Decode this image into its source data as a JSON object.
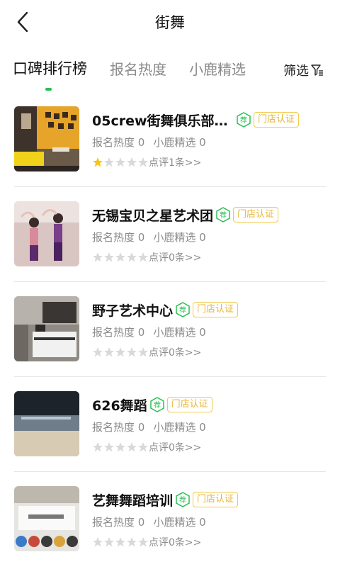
{
  "header": {
    "title": "街舞",
    "back_icon": "chevron-left-icon"
  },
  "tabs": [
    {
      "label": "口碑排行榜",
      "active": true
    },
    {
      "label": "报名热度",
      "active": false
    },
    {
      "label": "小鹿精选",
      "active": false
    }
  ],
  "filter": {
    "label": "筛选",
    "icon": "filter-icon"
  },
  "colors": {
    "accent": "#2bbf55",
    "cert": "#e8b634",
    "star_on": "#f5c518",
    "star_off": "#d9d9d9"
  },
  "items": [
    {
      "name": "05crew街舞俱乐部(大...",
      "rec_badge": "荐",
      "cert_badge": "门店认证",
      "signup": "报名热度 0",
      "picks": "小鹿精选 0",
      "rating": 1,
      "reviews": "点评1条>>"
    },
    {
      "name": "无锡宝贝之星艺术团",
      "rec_badge": "荐",
      "cert_badge": "门店认证",
      "signup": "报名热度 0",
      "picks": "小鹿精选 0",
      "rating": 0,
      "reviews": "点评0条>>"
    },
    {
      "name": "野子艺术中心",
      "rec_badge": "荐",
      "cert_badge": "门店认证",
      "signup": "报名热度 0",
      "picks": "小鹿精选 0",
      "rating": 0,
      "reviews": "点评0条>>"
    },
    {
      "name": "626舞蹈",
      "rec_badge": "荐",
      "cert_badge": "门店认证",
      "signup": "报名热度 0",
      "picks": "小鹿精选 0",
      "rating": 0,
      "reviews": "点评0条>>"
    },
    {
      "name": "艺舞舞蹈培训",
      "rec_badge": "荐",
      "cert_badge": "门店认证",
      "signup": "报名热度 0",
      "picks": "小鹿精选 0",
      "rating": 0,
      "reviews": "点评0条>>"
    }
  ]
}
